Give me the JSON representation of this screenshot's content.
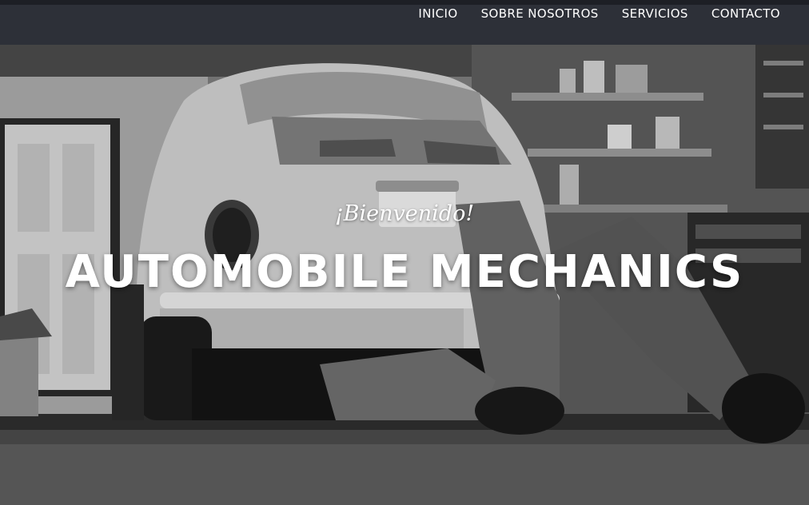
{
  "nav": {
    "items": [
      {
        "label": "INICIO"
      },
      {
        "label": "SOBRE NOSOTROS"
      },
      {
        "label": "SERVICIOS"
      },
      {
        "label": "CONTACTO"
      }
    ]
  },
  "hero": {
    "welcome": "¡Bienvenido!",
    "headline": "AUTOMOBILE MECHANICS",
    "image": "photo-mechanic-under-car-black-and-white"
  },
  "colors": {
    "topbar": "#2d3038",
    "text": "#ffffff"
  }
}
